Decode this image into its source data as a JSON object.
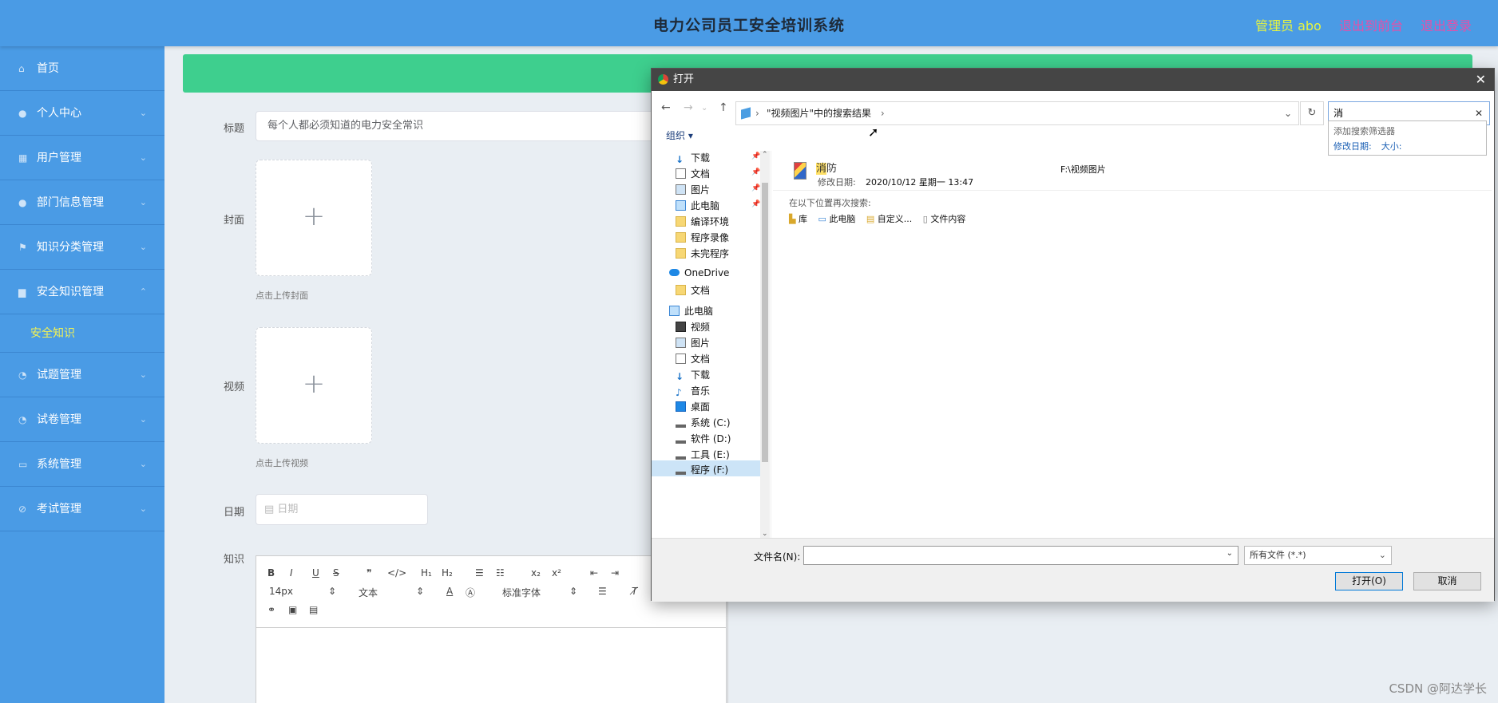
{
  "header": {
    "title": "电力公司员工安全培训系统",
    "admin_label": "管理员 abo",
    "back_link": "退出到前台",
    "logout_link": "退出登录"
  },
  "sidebar": {
    "items": [
      {
        "label": "首页",
        "icon": "home-icon"
      },
      {
        "label": "个人中心",
        "icon": "user-icon"
      },
      {
        "label": "用户管理",
        "icon": "table-icon"
      },
      {
        "label": "部门信息管理",
        "icon": "user-icon"
      },
      {
        "label": "知识分类管理",
        "icon": "flag-icon"
      },
      {
        "label": "安全知识管理",
        "icon": "briefcase-icon"
      },
      {
        "label": "试题管理",
        "icon": "clock-icon"
      },
      {
        "label": "试卷管理",
        "icon": "clock-icon"
      },
      {
        "label": "系统管理",
        "icon": "chat-icon"
      },
      {
        "label": "考试管理",
        "icon": "compass-icon"
      }
    ],
    "sub_item": "安全知识"
  },
  "form": {
    "title_label": "标题",
    "title_value": "每个人都必须知道的电力安全常识",
    "cover_label": "封面",
    "cover_hint": "点击上传封面",
    "video_label": "视频",
    "video_hint": "点击上传视频",
    "date_label": "日期",
    "date_placeholder": "日期",
    "knowledge_label": "知识",
    "editor": {
      "font_size": "14px",
      "text_style": "文本",
      "font_family": "标准字体"
    }
  },
  "dialog": {
    "title": "打开",
    "address": "\"视频图片\"中的搜索结果",
    "search_value": "消",
    "suggest_title": "添加搜索筛选器",
    "suggest_date": "修改日期:",
    "suggest_size": "大小:",
    "organize": "组织 ▾",
    "tree": {
      "quick": [
        "下载",
        "文档",
        "图片",
        "此电脑",
        "编译环境",
        "程序录像",
        "未完程序"
      ],
      "onedrive": "OneDrive",
      "onedrive_doc": "文档",
      "pc": "此电脑",
      "pc_items": [
        "视频",
        "图片",
        "文档",
        "下载",
        "音乐",
        "桌面",
        "系统 (C:)",
        "软件 (D:)",
        "工具 (E:)",
        "程序 (F:)"
      ]
    },
    "result": {
      "name_hl": "消",
      "name_rest": "防",
      "meta_label": "修改日期:",
      "meta_value": "2020/10/12 星期一 13:47",
      "path": "F:\\视频图片"
    },
    "research_label": "在以下位置再次搜索:",
    "research_items": [
      "库",
      "此电脑",
      "自定义...",
      "文件内容"
    ],
    "filename_label": "文件名(N):",
    "filetype": "所有文件 (*.*)",
    "open_btn": "打开(O)",
    "cancel_btn": "取消"
  },
  "watermark": "CSDN @阿达学长",
  "colors": {
    "header": "#4a9be5",
    "green_bar": "#3ecf8e",
    "admin": "#e8f53e",
    "links": "#e64fa8"
  }
}
